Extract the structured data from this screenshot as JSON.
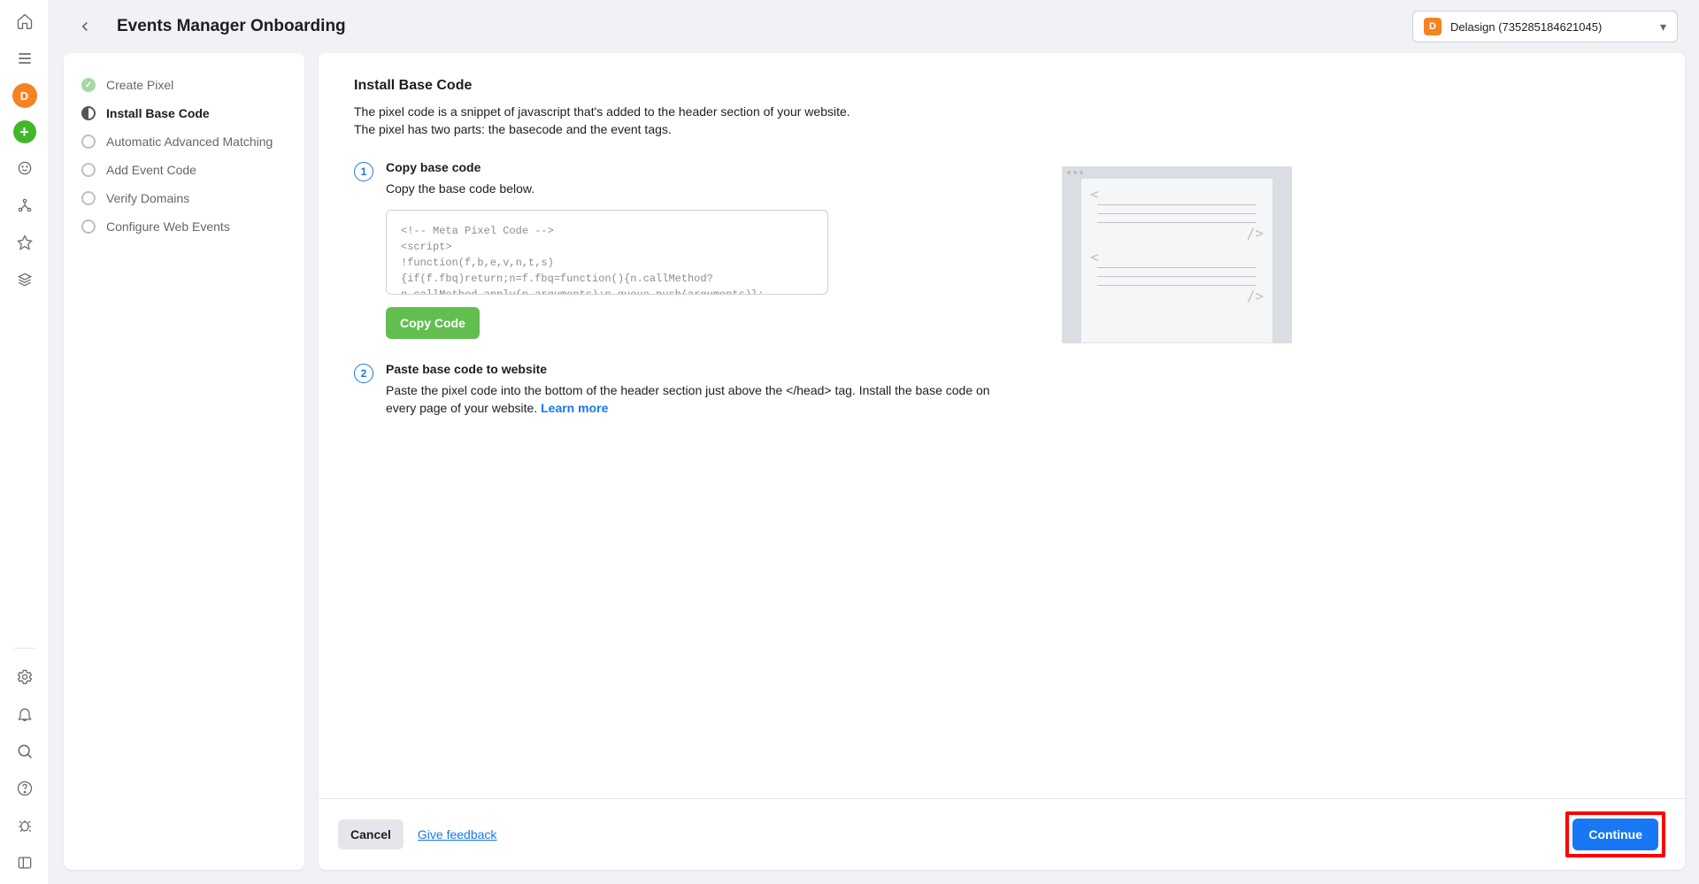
{
  "header": {
    "title": "Events Manager Onboarding",
    "account_badge": "D",
    "account_name": "Delasign (735285184621045)"
  },
  "rail": {
    "avatar": "D"
  },
  "steps": [
    {
      "label": "Create Pixel",
      "state": "done"
    },
    {
      "label": "Install Base Code",
      "state": "active"
    },
    {
      "label": "Automatic Advanced Matching",
      "state": "todo"
    },
    {
      "label": "Add Event Code",
      "state": "todo"
    },
    {
      "label": "Verify Domains",
      "state": "todo"
    },
    {
      "label": "Configure Web Events",
      "state": "todo"
    }
  ],
  "content": {
    "title": "Install Base Code",
    "desc1": "The pixel code is a snippet of javascript that's added to the header section of your website.",
    "desc2": "The pixel has two parts: the basecode and the event tags.",
    "step1_num": "1",
    "step1_title": "Copy base code",
    "step1_text": "Copy the base code below.",
    "code": "<!-- Meta Pixel Code -->\n<script>\n!function(f,b,e,v,n,t,s)\n{if(f.fbq)return;n=f.fbq=function(){n.callMethod?\nn.callMethod.apply(n,arguments):n.queue.push(arguments)};",
    "copy_label": "Copy Code",
    "step2_num": "2",
    "step2_title": "Paste base code to website",
    "step2_text_a": "Paste the pixel code into the bottom of the header section just above the </head> tag. Install the base code on every page of your website. ",
    "learn_more": "Learn more"
  },
  "footer": {
    "cancel": "Cancel",
    "feedback": "Give feedback",
    "continue": "Continue"
  }
}
